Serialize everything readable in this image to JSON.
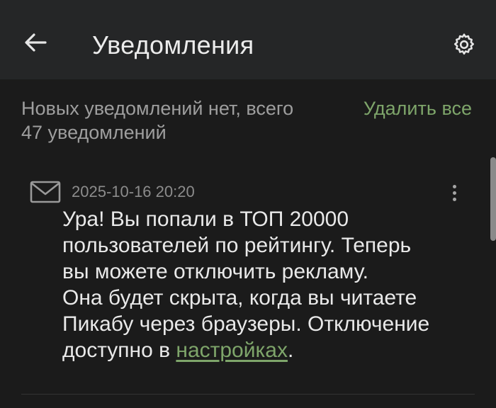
{
  "header": {
    "title": "Уведомления",
    "back_icon": "arrow-left-icon",
    "settings_icon": "gear-icon"
  },
  "summary": {
    "text_line1": "Новых уведомлений нет, всего",
    "text_line2": "47 уведомлений",
    "delete_all_label": "Удалить все"
  },
  "notifications": [
    {
      "icon": "mail-icon",
      "date": "2025-10-16 20:20",
      "lines": [
        "Ура! Вы попали в ТОП 20000",
        "пользователей по рейтингу. Теперь",
        "вы можете отключить рекламу.",
        "Она будет скрыта, когда вы читаете",
        "Пикабу через браузеры. Отключение"
      ],
      "last_line_prefix": "доступно в ",
      "link_text": "настройках",
      "last_line_suffix": "."
    }
  ],
  "colors": {
    "background": "#1b1b1b",
    "header_background": "#252627",
    "accent_green": "#7ea56a",
    "secondary_text": "#9e9e9e"
  }
}
